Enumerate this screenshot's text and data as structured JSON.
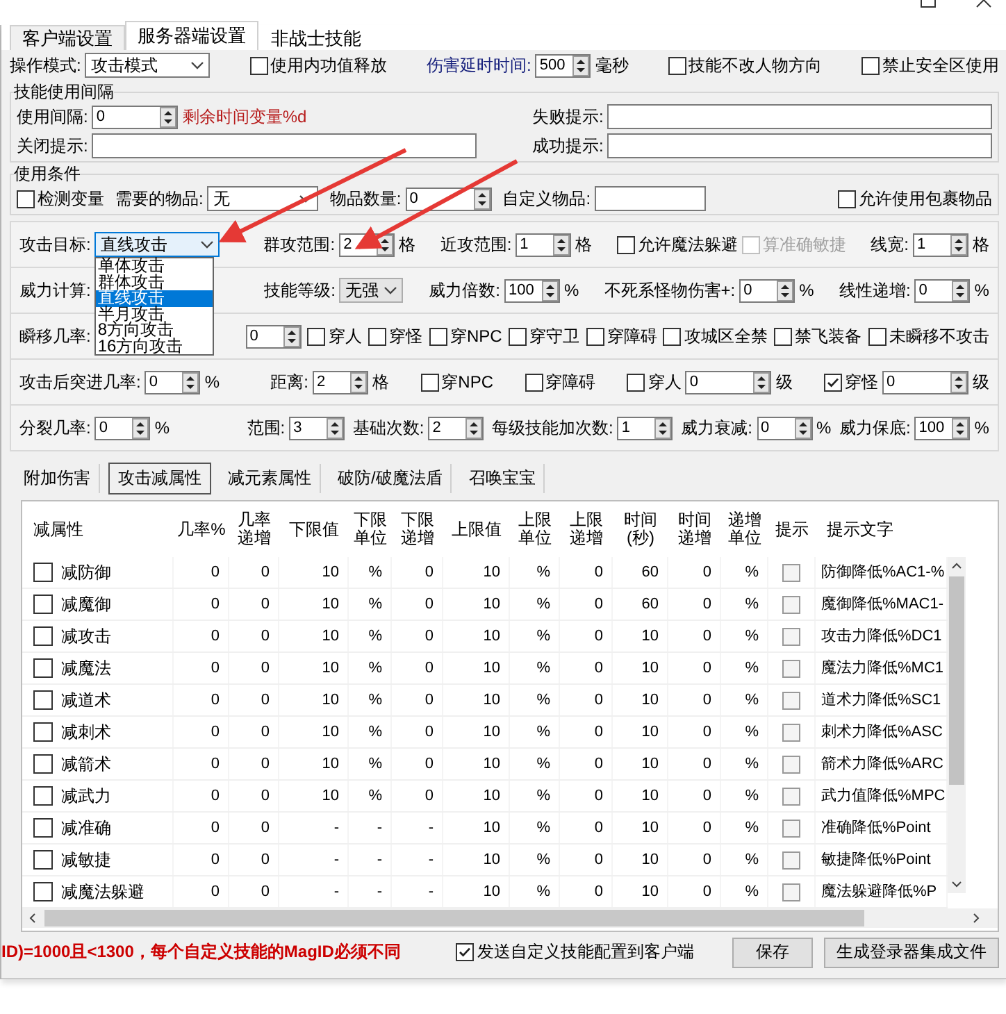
{
  "tabs": [
    {
      "label": "客户端设置",
      "selected": false
    },
    {
      "label": "服务器端设置",
      "selected": true
    },
    {
      "label": "非战士技能",
      "selected": false
    }
  ],
  "top_row": [
    [
      {
        "kind": "label",
        "text": "操作模式:"
      },
      {
        "kind": "combo",
        "value": "攻击模式"
      }
    ],
    [
      {
        "kind": "check",
        "text": "使用内功值释放",
        "checked": false
      }
    ],
    [
      {
        "kind": "blue_label",
        "text": "伤害延时时间:"
      },
      {
        "kind": "spin",
        "value": "500"
      },
      {
        "kind": "label",
        "text": "毫秒"
      }
    ],
    [
      {
        "kind": "check",
        "text": "技能不改人物方向",
        "checked": false
      }
    ],
    [
      {
        "kind": "check",
        "text": "禁止安全区使用",
        "checked": false
      }
    ]
  ],
  "interval_group": {
    "title": "技能使用间隔",
    "cells": [
      [
        {
          "kind": "label",
          "text": "使用间隔:"
        },
        {
          "kind": "spin",
          "value": "0",
          "wide": true
        },
        {
          "kind": "red_label",
          "text": "剩余时间变量%d"
        }
      ],
      [
        {
          "kind": "label",
          "text": "失败提示:"
        },
        {
          "kind": "text"
        }
      ],
      [
        {
          "kind": "label",
          "text": "关闭提示:"
        },
        {
          "kind": "text"
        }
      ],
      [
        {
          "kind": "label",
          "text": "成功提示:"
        },
        {
          "kind": "text"
        }
      ]
    ]
  },
  "condition_group": {
    "title": "使用条件",
    "groups": [
      [
        {
          "kind": "check",
          "text": "检测变量",
          "checked": false
        }
      ],
      [
        {
          "kind": "label",
          "text": "需要的物品:"
        },
        {
          "kind": "combo",
          "value": "无"
        }
      ],
      [
        {
          "kind": "label",
          "text": "物品数量:"
        },
        {
          "kind": "spin",
          "value": "0",
          "wide": true
        }
      ],
      [
        {
          "kind": "label",
          "text": "自定义物品:"
        },
        {
          "kind": "text"
        }
      ],
      [
        {
          "kind": "check",
          "text": "允许使用包裹物品",
          "checked": false
        }
      ]
    ]
  },
  "attack_rows": [
    {
      "groups": [
        [
          {
            "kind": "label",
            "text": "攻击目标:"
          },
          {
            "kind": "combo",
            "value": "直线攻击",
            "options": [
              {
                "label": "单体攻击",
                "selected": false
              },
              {
                "label": "群体攻击",
                "selected": false
              },
              {
                "label": "直线攻击",
                "selected": true
              },
              {
                "label": "半月攻击",
                "selected": false
              },
              {
                "label": "8方向攻击",
                "selected": false
              },
              {
                "label": "16方向攻击",
                "selected": false
              }
            ]
          }
        ],
        [
          {
            "kind": "label",
            "text": "群攻范围:"
          },
          {
            "kind": "spin",
            "value": "2"
          },
          {
            "kind": "label",
            "text": "格"
          }
        ],
        [
          {
            "kind": "label",
            "text": "近攻范围:"
          },
          {
            "kind": "spin",
            "value": "1"
          },
          {
            "kind": "label",
            "text": "格"
          }
        ],
        [
          {
            "kind": "check",
            "text": "允许魔法躲避",
            "checked": false
          },
          {
            "kind": "check",
            "text": "算准确敏捷",
            "checked": false,
            "disabled": true
          }
        ],
        [
          {
            "kind": "label",
            "text": "线宽:"
          },
          {
            "kind": "spin",
            "value": "1"
          },
          {
            "kind": "label",
            "text": "格"
          }
        ]
      ]
    },
    {
      "groups": [
        [
          {
            "kind": "label",
            "text": "威力计算:"
          }
        ],
        [
          {
            "kind": "label",
            "text": "技能等级:"
          },
          {
            "kind": "combo",
            "value": "无强",
            "disabled": true
          }
        ],
        [
          {
            "kind": "label",
            "text": "威力倍数:"
          },
          {
            "kind": "spin",
            "value": "100"
          },
          {
            "kind": "label",
            "text": "%"
          }
        ],
        [
          {
            "kind": "label",
            "text": "不死系怪物伤害+:"
          },
          {
            "kind": "spin",
            "value": "0"
          },
          {
            "kind": "label",
            "text": "%"
          }
        ],
        [
          {
            "kind": "label",
            "text": "线性递增:"
          },
          {
            "kind": "spin",
            "value": "0"
          },
          {
            "kind": "label",
            "text": "%"
          }
        ]
      ]
    },
    {
      "groups": [
        [
          {
            "kind": "label",
            "text": "瞬移几率:"
          }
        ],
        [
          {
            "kind": "spin",
            "value": "0"
          }
        ],
        [
          {
            "kind": "check",
            "text": "穿人",
            "checked": false
          }
        ],
        [
          {
            "kind": "check",
            "text": "穿怪",
            "checked": false
          }
        ],
        [
          {
            "kind": "check",
            "text": "穿NPC",
            "checked": false
          }
        ],
        [
          {
            "kind": "check",
            "text": "穿守卫",
            "checked": false
          }
        ],
        [
          {
            "kind": "check",
            "text": "穿障碍",
            "checked": false
          }
        ],
        [
          {
            "kind": "check",
            "text": "攻城区全禁",
            "checked": false
          }
        ],
        [
          {
            "kind": "check",
            "text": "禁飞装备",
            "checked": false
          }
        ],
        [
          {
            "kind": "check",
            "text": "未瞬移不攻击",
            "checked": false
          }
        ]
      ]
    },
    {
      "groups": [
        [
          {
            "kind": "label",
            "text": "攻击后突进几率:"
          },
          {
            "kind": "spin",
            "value": "0"
          },
          {
            "kind": "label",
            "text": "%"
          }
        ],
        [
          {
            "kind": "label",
            "text": "距离:"
          },
          {
            "kind": "spin",
            "value": "2"
          },
          {
            "kind": "label",
            "text": "格"
          }
        ],
        [
          {
            "kind": "check",
            "text": "穿NPC",
            "checked": false
          }
        ],
        [
          {
            "kind": "check",
            "text": "穿障碍",
            "checked": false
          }
        ],
        [
          {
            "kind": "check",
            "text": "穿人",
            "checked": false
          },
          {
            "kind": "spin",
            "value": "0",
            "wide": true
          },
          {
            "kind": "label",
            "text": "级"
          }
        ],
        [
          {
            "kind": "check",
            "text": "穿怪",
            "checked": true
          },
          {
            "kind": "spin",
            "value": "0",
            "wide": true
          },
          {
            "kind": "label",
            "text": "级"
          }
        ]
      ]
    },
    {
      "groups": [
        [
          {
            "kind": "label",
            "text": "分裂几率:"
          },
          {
            "kind": "spin",
            "value": "0"
          },
          {
            "kind": "label",
            "text": "%"
          }
        ],
        [
          {
            "kind": "label",
            "text": "范围:"
          },
          {
            "kind": "spin",
            "value": "3"
          }
        ],
        [
          {
            "kind": "label",
            "text": "基础次数:"
          },
          {
            "kind": "spin",
            "value": "2"
          }
        ],
        [
          {
            "kind": "label",
            "text": "每级技能加次数:"
          },
          {
            "kind": "spin",
            "value": "1"
          }
        ],
        [
          {
            "kind": "label",
            "text": "威力衰减:"
          },
          {
            "kind": "spin",
            "value": "0"
          },
          {
            "kind": "label",
            "text": "%"
          }
        ],
        [
          {
            "kind": "label",
            "text": "威力保底:"
          },
          {
            "kind": "spin",
            "value": "100"
          },
          {
            "kind": "label",
            "text": "%"
          }
        ]
      ]
    }
  ],
  "sub_tabs": [
    {
      "label": "附加伤害",
      "selected": false
    },
    {
      "label": "攻击减属性",
      "selected": true
    },
    {
      "label": "减元素属性",
      "selected": false
    },
    {
      "label": "破防/破魔法盾",
      "selected": false
    },
    {
      "label": "召唤宝宝",
      "selected": false
    }
  ],
  "table": {
    "columns": [
      "减属性",
      "几率%",
      "几率递增",
      "下限值",
      "下限单位",
      "下限递增",
      "上限值",
      "上限单位",
      "上限递增",
      "时间(秒)",
      "时间递增",
      "递增单位",
      "提示",
      "提示文字"
    ],
    "rows": [
      {
        "checked": false,
        "hint": false,
        "cells": [
          "减防御",
          "0",
          "0",
          "10",
          "%",
          "0",
          "10",
          "%",
          "0",
          "60",
          "0",
          "%",
          "",
          "防御降低%AC1-%"
        ]
      },
      {
        "checked": false,
        "hint": false,
        "cells": [
          "减魔御",
          "0",
          "0",
          "10",
          "%",
          "0",
          "10",
          "%",
          "0",
          "60",
          "0",
          "%",
          "",
          "魔御降低%MAC1-"
        ]
      },
      {
        "checked": false,
        "hint": false,
        "cells": [
          "减攻击",
          "0",
          "0",
          "10",
          "%",
          "0",
          "10",
          "%",
          "0",
          "10",
          "0",
          "%",
          "",
          "攻击力降低%DC1"
        ]
      },
      {
        "checked": false,
        "hint": false,
        "cells": [
          "减魔法",
          "0",
          "0",
          "10",
          "%",
          "0",
          "10",
          "%",
          "0",
          "10",
          "0",
          "%",
          "",
          "魔法力降低%MC1"
        ]
      },
      {
        "checked": false,
        "hint": false,
        "cells": [
          "减道术",
          "0",
          "0",
          "10",
          "%",
          "0",
          "10",
          "%",
          "0",
          "10",
          "0",
          "%",
          "",
          "道术力降低%SC1"
        ]
      },
      {
        "checked": false,
        "hint": false,
        "cells": [
          "减刺术",
          "0",
          "0",
          "10",
          "%",
          "0",
          "10",
          "%",
          "0",
          "10",
          "0",
          "%",
          "",
          "刺术力降低%ASC"
        ]
      },
      {
        "checked": false,
        "hint": false,
        "cells": [
          "减箭术",
          "0",
          "0",
          "10",
          "%",
          "0",
          "10",
          "%",
          "0",
          "10",
          "0",
          "%",
          "",
          "箭术力降低%ARC"
        ]
      },
      {
        "checked": false,
        "hint": false,
        "cells": [
          "减武力",
          "0",
          "0",
          "10",
          "%",
          "0",
          "10",
          "%",
          "0",
          "10",
          "0",
          "%",
          "",
          "武力值降低%MPC"
        ]
      },
      {
        "checked": false,
        "hint": false,
        "cells": [
          "减准确",
          "0",
          "0",
          "-",
          "-",
          "-",
          "10",
          "%",
          "0",
          "10",
          "0",
          "%",
          "",
          "准确降低%Point"
        ]
      },
      {
        "checked": false,
        "hint": false,
        "cells": [
          "减敏捷",
          "0",
          "0",
          "-",
          "-",
          "-",
          "10",
          "%",
          "0",
          "10",
          "0",
          "%",
          "",
          "敏捷降低%Point"
        ]
      },
      {
        "checked": false,
        "hint": false,
        "cells": [
          "减魔法躲避",
          "0",
          "0",
          "-",
          "-",
          "-",
          "10",
          "%",
          "0",
          "10",
          "0",
          "%",
          "",
          "魔法躲避降低%P"
        ]
      }
    ]
  },
  "footer": {
    "note": "ID)=1000且<1300，每个自定义技能的MagID必须不同",
    "send_config": {
      "label": "发送自定义技能配置到客户端",
      "checked": true
    },
    "buttons": [
      "保存",
      "生成登录器集成文件"
    ]
  }
}
